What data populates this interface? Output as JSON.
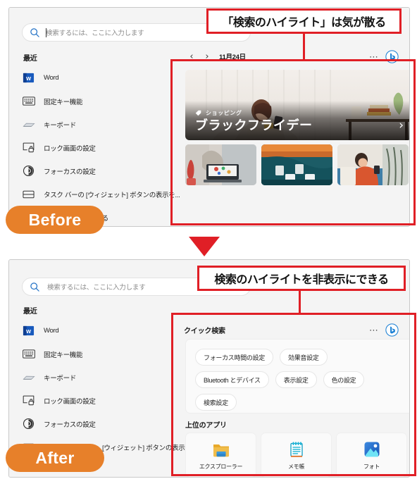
{
  "search": {
    "placeholder": "検索するには、ここに入力します",
    "icon": "search-icon"
  },
  "sidebar": {
    "heading": "最近",
    "items_before": [
      {
        "label": "Word",
        "icon": "word-app-icon"
      },
      {
        "label": "固定キー機能",
        "icon": "keyboard-sticky-keys-icon"
      },
      {
        "label": "キーボード",
        "icon": "keyboard-device-icon"
      },
      {
        "label": "ロック画面の設定",
        "icon": "lock-screen-icon"
      },
      {
        "label": "フォーカスの設定",
        "icon": "focus-icon"
      },
      {
        "label": "タスク バーの [ウィジェット] ボタンの表示を...",
        "icon": "taskbar-widgets-icon"
      },
      {
        "label": "オプションを編集する",
        "icon": "edit-options-icon"
      }
    ],
    "items_after": [
      {
        "label": "Word",
        "icon": "word-app-icon"
      },
      {
        "label": "固定キー機能",
        "icon": "keyboard-sticky-keys-icon"
      },
      {
        "label": "キーボード",
        "icon": "keyboard-device-icon"
      },
      {
        "label": "ロック画面の設定",
        "icon": "lock-screen-icon"
      },
      {
        "label": "フォーカスの設定",
        "icon": "focus-icon"
      },
      {
        "label": "[ウィジェット] ボタンの表示を制...",
        "icon": "taskbar-widgets-icon"
      }
    ]
  },
  "before_pane": {
    "date": "11月24日",
    "prev_icon": "chevron-left-icon",
    "next_icon": "chevron-right-icon",
    "more_icon": "ellipsis-icon",
    "bing_icon": "bing-logo-icon",
    "hero": {
      "tag": "ショッピング",
      "tag_icon": "price-tag-icon",
      "title": "ブラックフライデー",
      "next_icon": "chevron-right-icon"
    },
    "thumbnails": [
      "thumbnail-laptop-desk",
      "thumbnail-coffee-machine",
      "thumbnail-woman-sofa"
    ]
  },
  "after_pane": {
    "quick_search_title": "クイック検索",
    "more_icon": "ellipsis-icon",
    "bing_icon": "bing-logo-icon",
    "chips": [
      "フォーカス時間の設定",
      "効果音設定",
      "Bluetooth とデバイス",
      "表示設定",
      "色の設定",
      "検索設定"
    ],
    "top_apps_title": "上位のアプリ",
    "apps": [
      {
        "label": "エクスプローラー",
        "icon": "file-explorer-icon"
      },
      {
        "label": "メモ帳",
        "icon": "notepad-icon"
      },
      {
        "label": "フォト",
        "icon": "photos-icon"
      }
    ]
  },
  "annotations": {
    "callout_before": "「検索のハイライト」は気が散る",
    "callout_after": "検索のハイライトを非表示にできる",
    "badge_before": "Before",
    "badge_after": "After",
    "accent_red": "#e01f26",
    "accent_orange": "#e7802a"
  }
}
